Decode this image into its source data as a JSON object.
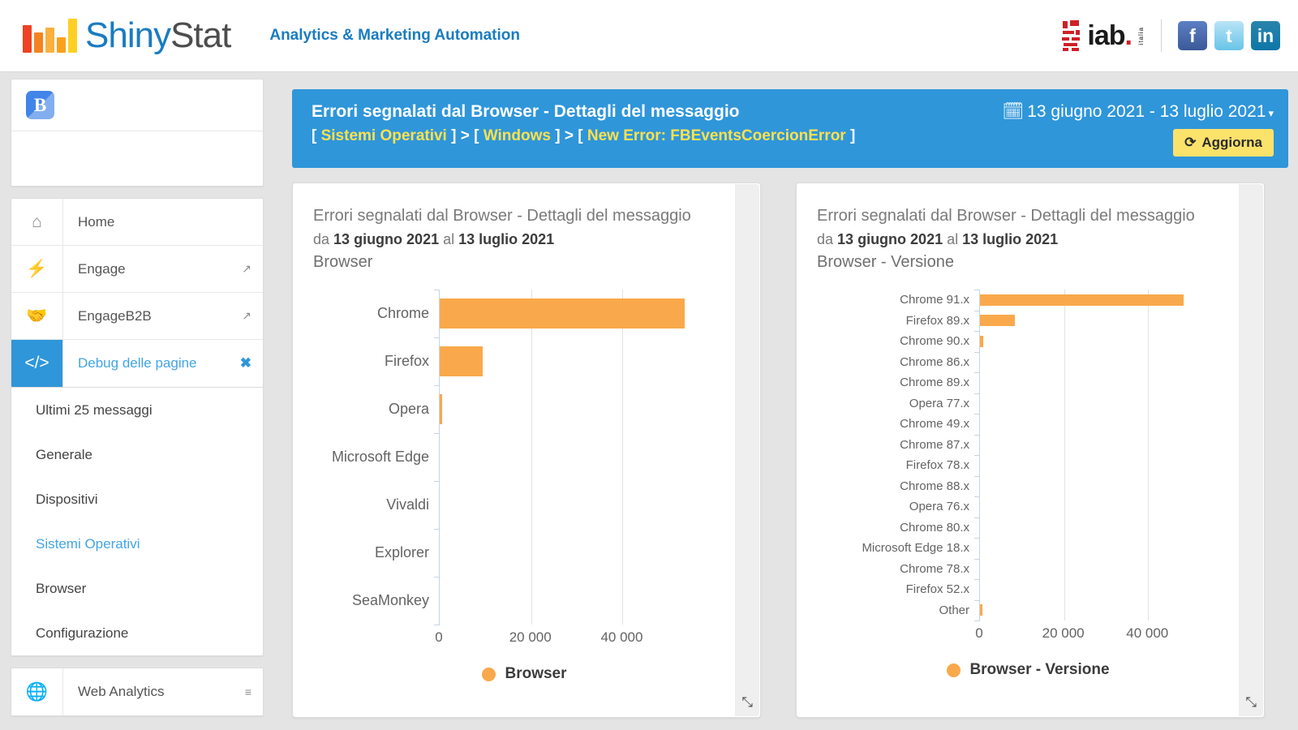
{
  "topbar": {
    "brand_shiny": "Shiny",
    "brand_stat": "Stat",
    "tagline": "Analytics & Marketing Automation",
    "iab_text": "iab",
    "iab_dot": ".",
    "iab_italia": "italia",
    "social": [
      {
        "name": "facebook",
        "glyph": "f"
      },
      {
        "name": "twitter",
        "glyph": "t"
      },
      {
        "name": "linkedin",
        "glyph": "in"
      }
    ]
  },
  "sidebar": {
    "account_badge": "B",
    "nav": [
      {
        "label": "Home",
        "icon": "home-icon",
        "glyph": "⌂",
        "external": "",
        "active": false
      },
      {
        "label": "Engage",
        "icon": "bolt-icon",
        "glyph": "⚡",
        "external": "↗",
        "active": false
      },
      {
        "label": "EngageB2B",
        "icon": "handshake-icon",
        "glyph": "🤝",
        "external": "↗",
        "active": false
      },
      {
        "label": "Debug delle pagine",
        "icon": "code-icon",
        "glyph": "</>",
        "external": "✖",
        "active": true
      }
    ],
    "subitems": [
      {
        "label": "Ultimi 25 messaggi",
        "selected": false
      },
      {
        "label": "Generale",
        "selected": false
      },
      {
        "label": "Dispositivi",
        "selected": false
      },
      {
        "label": "Sistemi Operativi",
        "selected": true
      },
      {
        "label": "Browser",
        "selected": false
      },
      {
        "label": "Configurazione",
        "selected": false
      }
    ],
    "footer": {
      "label": "Web Analytics",
      "icon": "globe-icon",
      "glyph": "🌐",
      "menu": "≡"
    }
  },
  "page_header": {
    "title": "Errori segnalati dal Browser - Dettagli del messaggio",
    "breadcrumb": [
      {
        "text": "Sistemi Operativi",
        "type": "link"
      },
      {
        "text": "Windows",
        "type": "link"
      },
      {
        "text": "New Error: FBEventsCoercionError",
        "type": "link"
      }
    ],
    "breadcrumb_separator": ">",
    "bracket_open": "[",
    "bracket_close": "]",
    "date_range": "13 giugno 2021 - 13 luglio 2021",
    "calendar_icon": "🗓",
    "caret": "▾",
    "refresh_label": "Aggiorna",
    "refresh_icon": "⟳",
    "accent_color": "#2f96da",
    "link_color": "#ffe14d",
    "button_color": "#fbe26b"
  },
  "panels": [
    {
      "title": "Errori segnalati dal Browser - Dettagli del messaggio",
      "sub_prefix": "da",
      "sub_from": "13 giugno 2021",
      "sub_mid": "al",
      "sub_to": "13 luglio 2021",
      "metric": "Browser",
      "expand_icon": "⤡"
    },
    {
      "title": "Errori segnalati dal Browser - Dettagli del messaggio",
      "sub_prefix": "da",
      "sub_from": "13 giugno 2021",
      "sub_mid": "al",
      "sub_to": "13 luglio 2021",
      "metric": "Browser - Versione",
      "expand_icon": "⤡"
    }
  ],
  "chart_data": [
    {
      "type": "bar",
      "orientation": "horizontal",
      "title": "Errori segnalati dal Browser - Dettagli del messaggio",
      "subtitle": "da 13 giugno 2021 al 13 luglio 2021",
      "xlabel": "",
      "ylabel": "Browser",
      "categories": [
        "Chrome",
        "Firefox",
        "Opera",
        "Microsoft Edge",
        "Vivaldi",
        "Explorer",
        "SeaMonkey"
      ],
      "values": [
        53500,
        9400,
        500,
        0,
        0,
        0,
        0
      ],
      "xlim": [
        0,
        55000
      ],
      "xticks": [
        0,
        20000,
        40000
      ],
      "xtick_labels": [
        "0",
        "20 000",
        "40 000"
      ],
      "legend": [
        "Browser"
      ],
      "legend_position": "bottom",
      "grid": true,
      "series_color": "#f9a94c"
    },
    {
      "type": "bar",
      "orientation": "horizontal",
      "title": "Errori segnalati dal Browser - Dettagli del messaggio",
      "subtitle": "da 13 giugno 2021 al 13 luglio 2021",
      "xlabel": "",
      "ylabel": "Browser - Versione",
      "categories": [
        "Chrome 91.x",
        "Firefox 89.x",
        "Chrome 90.x",
        "Chrome 86.x",
        "Chrome 89.x",
        "Opera 77.x",
        "Chrome 49.x",
        "Chrome 87.x",
        "Firefox 78.x",
        "Chrome 88.x",
        "Opera 76.x",
        "Chrome 80.x",
        "Microsoft Edge 18.x",
        "Chrome 78.x",
        "Firefox 52.x",
        "Other"
      ],
      "values": [
        48500,
        8300,
        700,
        0,
        0,
        0,
        0,
        0,
        0,
        0,
        0,
        0,
        0,
        0,
        0,
        600
      ],
      "xlim": [
        0,
        55000
      ],
      "xticks": [
        0,
        20000,
        40000
      ],
      "xtick_labels": [
        "0",
        "20 000",
        "40 000"
      ],
      "legend": [
        "Browser - Versione"
      ],
      "legend_position": "bottom",
      "grid": true,
      "series_color": "#f9a94c"
    }
  ]
}
